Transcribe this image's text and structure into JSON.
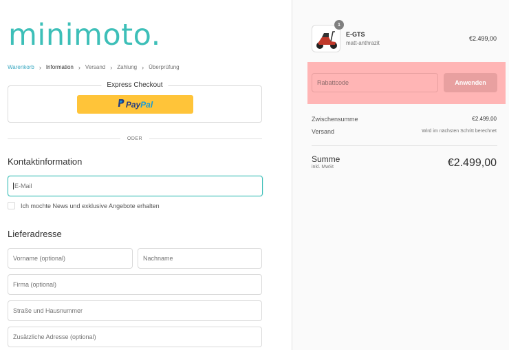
{
  "brand": {
    "logo_text": "minimoto.",
    "color": "#3dbfb8"
  },
  "breadcrumb": [
    {
      "label": "Warenkorb",
      "state": "link"
    },
    {
      "label": "Information",
      "state": "active"
    },
    {
      "label": "Versand",
      "state": "upcoming"
    },
    {
      "label": "Zahlung",
      "state": "upcoming"
    },
    {
      "label": "Überprüfung",
      "state": "upcoming"
    }
  ],
  "express": {
    "title": "Express Checkout",
    "paypal_pay": "Pay",
    "paypal_pal": "Pal"
  },
  "divider": {
    "label": "ODER"
  },
  "contact": {
    "title": "Kontaktinformation",
    "email_placeholder": "E-Mail",
    "newsletter_label": "Ich mochte News und exklusive Angebote erhalten"
  },
  "shipping": {
    "title": "Lieferadresse",
    "first_name": "Vorname (optional)",
    "last_name": "Nachname",
    "company": "Firma (optional)",
    "street": "Straße und Hausnummer",
    "address2": "Zusätzliche Adresse (optional)"
  },
  "cart": {
    "item": {
      "quantity": "1",
      "name": "E-GTS",
      "variant": "matt-anthrazit",
      "price": "€2.499,00"
    }
  },
  "discount": {
    "placeholder": "Rabattcode",
    "apply_label": "Anwenden"
  },
  "summary": {
    "subtotal_label": "Zwischensumme",
    "subtotal_value": "€2.499,00",
    "shipping_label": "Versand",
    "shipping_value": "Wird im nächsten Schritt berechnet",
    "total_label": "Summe",
    "tax_note": "inkl. MwSt",
    "total_value": "€2.499,00"
  }
}
